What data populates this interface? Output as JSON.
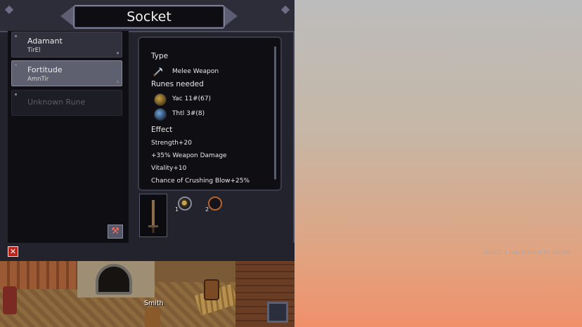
{
  "window": {
    "title": "Socket"
  },
  "runes": [
    {
      "name": "Adamant",
      "code": "TirEl",
      "state": "normal"
    },
    {
      "name": "Fortitude",
      "code": "AmnTir",
      "state": "selected"
    },
    {
      "name": "Unknown Rune",
      "code": "",
      "state": "locked"
    }
  ],
  "details": {
    "type_heading": "Type",
    "type_value": "Melee Weapon",
    "runes_heading": "Runes needed",
    "runes_needed": [
      {
        "label": "Yac 11#(67)",
        "icon": "yac-rune-icon"
      },
      {
        "label": "Thtl 3#(8)",
        "icon": "thtl-rune-icon"
      }
    ],
    "effect_heading": "Effect",
    "effects": [
      "Strength+20",
      "+35% Weapon Damage",
      "Vitality+10",
      "Chance of Crushing Blow+25%"
    ]
  },
  "sockets": {
    "slot1_number": "1",
    "slot2_number": "2"
  },
  "footer": {
    "hint": "Select a equipment to socket"
  },
  "scene": {
    "npc_name": "Smith"
  },
  "colors": {
    "panel_bg": "#23232d",
    "selected_item": "#5e606f",
    "close_button": "#b8241a",
    "socket_empty_ring": "#b0642c"
  }
}
